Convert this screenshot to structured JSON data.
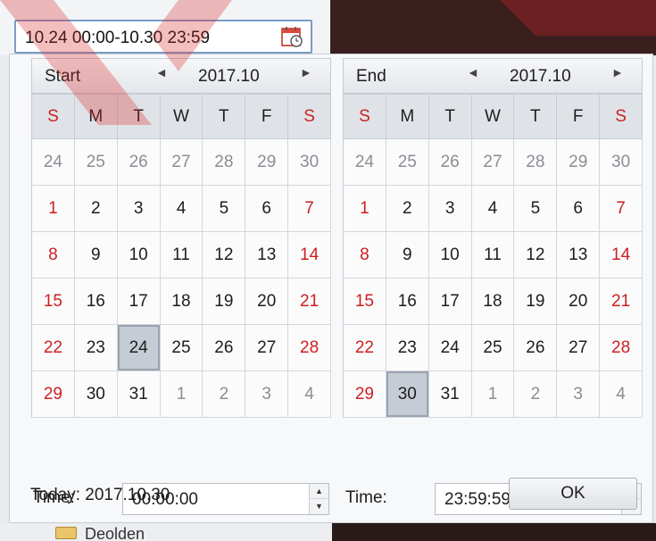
{
  "range": {
    "value": "10.24 00:00-10.30 23:59",
    "icon": "calendar-icon"
  },
  "start": {
    "label": "Start",
    "month": "2017.10",
    "prev_icon": "◄",
    "next_icon": "►",
    "weekdays": [
      "S",
      "M",
      "T",
      "W",
      "T",
      "F",
      "S"
    ],
    "days": [
      "24",
      "25",
      "26",
      "27",
      "28",
      "29",
      "30",
      "1",
      "2",
      "3",
      "4",
      "5",
      "6",
      "7",
      "8",
      "9",
      "10",
      "11",
      "12",
      "13",
      "14",
      "15",
      "16",
      "17",
      "18",
      "19",
      "20",
      "21",
      "22",
      "23",
      "24",
      "25",
      "26",
      "27",
      "28",
      "29",
      "30",
      "31",
      "1",
      "2",
      "3",
      "4"
    ],
    "selected_index": 30,
    "time_label": "Time:",
    "time_value": "00:00:00"
  },
  "end": {
    "label": "End",
    "month": "2017.10",
    "prev_icon": "◄",
    "next_icon": "►",
    "weekdays": [
      "S",
      "M",
      "T",
      "W",
      "T",
      "F",
      "S"
    ],
    "days": [
      "24",
      "25",
      "26",
      "27",
      "28",
      "29",
      "30",
      "1",
      "2",
      "3",
      "4",
      "5",
      "6",
      "7",
      "8",
      "9",
      "10",
      "11",
      "12",
      "13",
      "14",
      "15",
      "16",
      "17",
      "18",
      "19",
      "20",
      "21",
      "22",
      "23",
      "24",
      "25",
      "26",
      "27",
      "28",
      "29",
      "30",
      "31",
      "1",
      "2",
      "3",
      "4"
    ],
    "selected_index": 36,
    "time_label": "Time:",
    "time_value": "23:59:59"
  },
  "footer": {
    "today": "Today: 2017.10.30",
    "ok": "OK"
  },
  "behind": {
    "folder": "Deolden"
  },
  "colors": {
    "weekend": "#cc1f1f",
    "selected": "#c6ccd5",
    "accent_border": "#7a9cc6"
  }
}
